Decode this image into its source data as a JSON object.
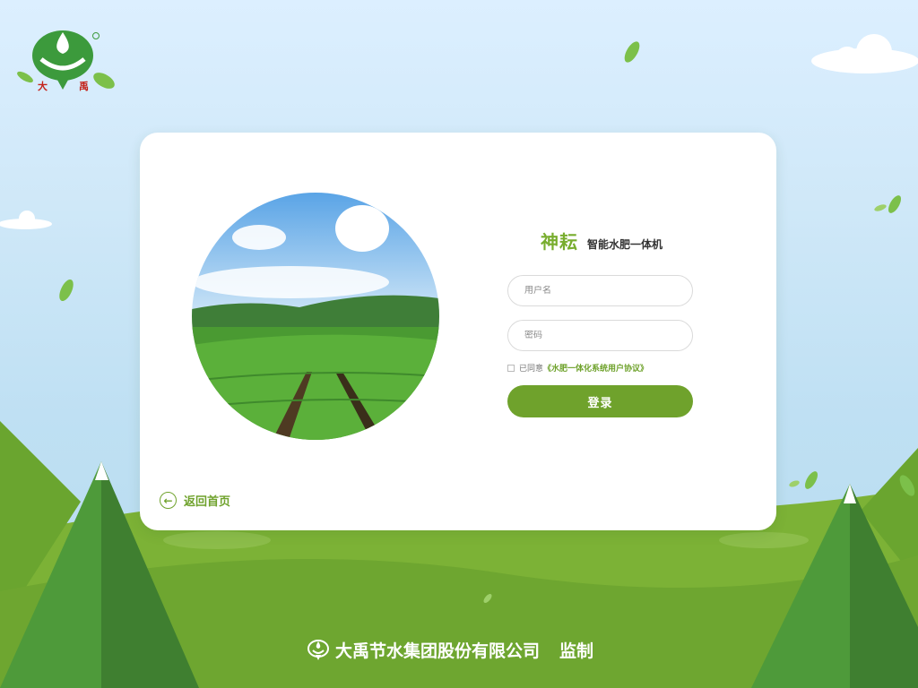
{
  "logo": {
    "brand_left": "大",
    "brand_right": "禹"
  },
  "app": {
    "brand_name": "神耘",
    "product_name": "智能水肥一体机"
  },
  "login_form": {
    "username_placeholder": "用户名",
    "password_placeholder": "密码",
    "agree_prefix": "已同意",
    "agreement_link": "《水肥一体化系统用户协议》",
    "login_button": "登录"
  },
  "nav": {
    "back_home": "返回首页"
  },
  "footer": {
    "company": "大禹节水集团股份有限公司",
    "supervise": "监制"
  },
  "colors": {
    "accent": "#6fa22c",
    "brand_green": "#78ad2e",
    "logo_red": "#c4241c"
  }
}
